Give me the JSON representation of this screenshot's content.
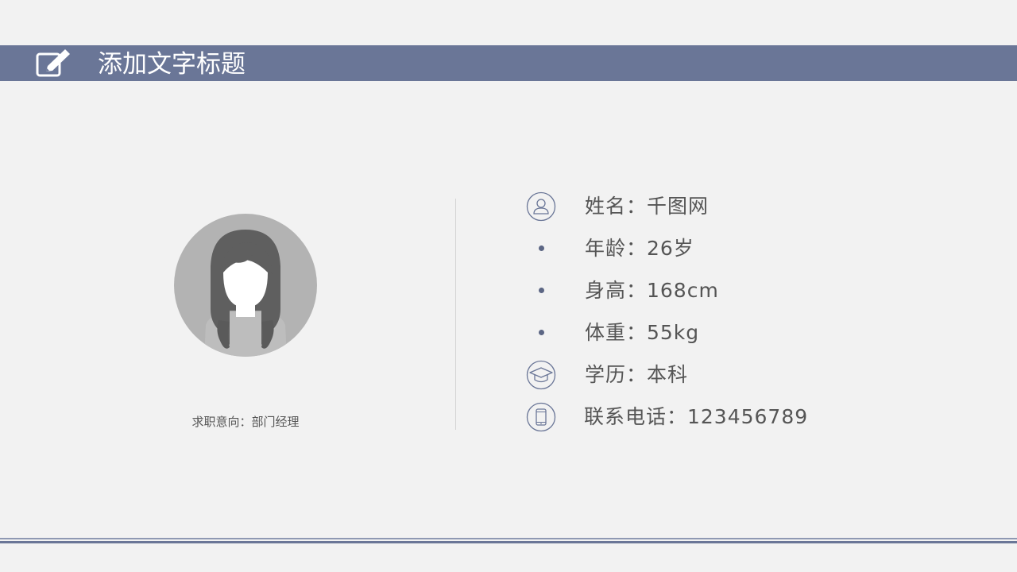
{
  "header": {
    "title": "添加文字标题",
    "icon": "edit-pencil-icon"
  },
  "profile": {
    "avatar_icon": "female-avatar-icon",
    "job_intention": "求职意向：部门经理"
  },
  "info": [
    {
      "icon": "person-circle-icon",
      "text": "姓名：千图网"
    },
    {
      "icon": "bullet-dot",
      "text": "年龄：26岁"
    },
    {
      "icon": "bullet-dot",
      "text": "身高：168cm"
    },
    {
      "icon": "bullet-dot",
      "text": "体重：55kg"
    },
    {
      "icon": "graduation-cap-icon",
      "text": "学历：本科"
    },
    {
      "icon": "mobile-phone-icon",
      "text": "联系电话：123456789"
    }
  ],
  "colors": {
    "accent": "#6a7697",
    "background": "#f2f2f2",
    "text": "#555555",
    "icon_stroke": "#6a7697"
  }
}
